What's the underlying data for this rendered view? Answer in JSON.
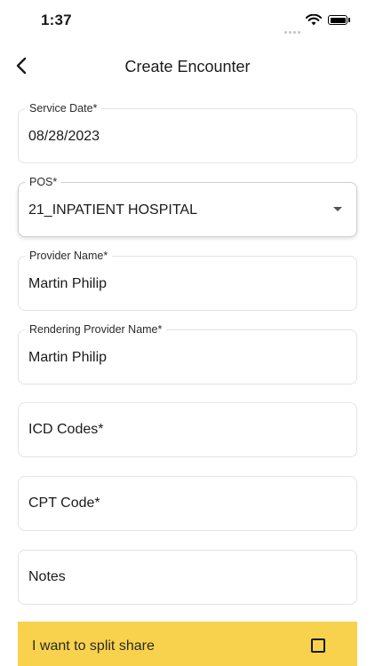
{
  "status_bar": {
    "time": "1:37"
  },
  "header": {
    "title": "Create Encounter"
  },
  "form": {
    "service_date": {
      "label": "Service Date*",
      "value": "08/28/2023"
    },
    "pos": {
      "label": "POS*",
      "value": "21_INPATIENT HOSPITAL"
    },
    "provider_name": {
      "label": "Provider Name*",
      "value": "Martin Philip"
    },
    "rendering_provider_name": {
      "label": "Rendering Provider Name*",
      "value": "Martin Philip"
    },
    "icd_codes": {
      "placeholder": "ICD Codes*"
    },
    "cpt_code": {
      "placeholder": "CPT Code*"
    },
    "notes": {
      "placeholder": "Notes"
    }
  },
  "split_share": {
    "label": "I want to split share",
    "checked": false
  },
  "colors": {
    "accent": "#f8d24c",
    "border": "#e3e3e3"
  }
}
